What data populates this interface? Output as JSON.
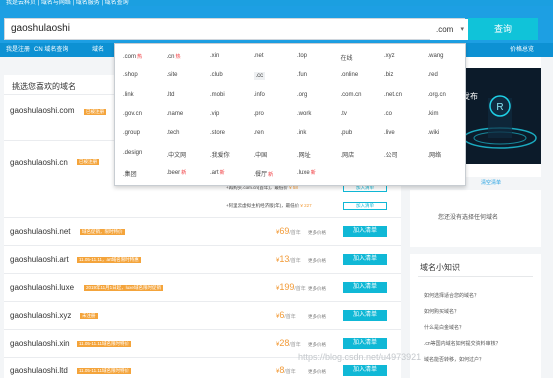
{
  "topbar": {
    "text": "我是云科贝 | 域名与网络 | 域名服务 | 域名查询"
  },
  "search": {
    "value": "gaoshulaoshi",
    "tld_selected": ".com",
    "button": "查询"
  },
  "subnav": {
    "items": [
      "我是注册",
      "CN 域名查询",
      "域名",
      "价格总览"
    ]
  },
  "dropdown": [
    {
      "t": ".com",
      "hot": "热"
    },
    {
      "t": ".cn",
      "hot": "热"
    },
    {
      "t": ".xin"
    },
    {
      "t": ".net"
    },
    {
      "t": ".top"
    },
    {
      "t": "在线"
    },
    {
      "t": ".xyz"
    },
    {
      "t": ".wang"
    },
    {
      "t": ".shop"
    },
    {
      "t": ".site"
    },
    {
      "t": ".club"
    },
    {
      "t": ".cc"
    },
    {
      "t": ".fun"
    },
    {
      "t": ".online"
    },
    {
      "t": ".biz"
    },
    {
      "t": ".red"
    },
    {
      "t": ".link"
    },
    {
      "t": ".ltd"
    },
    {
      "t": ".mobi"
    },
    {
      "t": ".info"
    },
    {
      "t": ".org"
    },
    {
      "t": ".com.cn"
    },
    {
      "t": ".net.cn"
    },
    {
      "t": ".org.cn"
    },
    {
      "t": ".gov.cn"
    },
    {
      "t": ".name"
    },
    {
      "t": ".vip"
    },
    {
      "t": ".pro"
    },
    {
      "t": ".work"
    },
    {
      "t": ".tv"
    },
    {
      "t": ".co"
    },
    {
      "t": ".kim"
    },
    {
      "t": ".group"
    },
    {
      "t": ".tech"
    },
    {
      "t": ".store"
    },
    {
      "t": ".ren"
    },
    {
      "t": ".ink"
    },
    {
      "t": ".pub"
    },
    {
      "t": ".live"
    },
    {
      "t": ".wiki"
    },
    {
      "t": ".design"
    },
    {
      "t": ".中文网"
    },
    {
      "t": ".我爱你"
    },
    {
      "t": ".中国"
    },
    {
      "t": ".网址"
    },
    {
      "t": ".网店"
    },
    {
      "t": ".公司"
    },
    {
      "t": ".网络"
    },
    {
      "t": ".集团"
    },
    {
      "t": ".beer",
      "hot": "新"
    },
    {
      "t": ".art",
      "hot": "新"
    },
    {
      "t": ".餐厅",
      "hot": "新"
    },
    {
      "t": ".luxe",
      "hot": "新"
    }
  ],
  "left": {
    "heading": "挑选您喜欢的域名",
    "rows": [
      {
        "name": "gaoshulaoshi.com",
        "tag": "已被注册"
      },
      {
        "name": "gaoshulaoshi.cn",
        "tag": "已被注册"
      },
      {
        "name": "gaoshulaoshi.net",
        "tag": "域名促销，限时特价",
        "price": "69",
        "more": "更多价格",
        "add": "加入清单"
      },
      {
        "name": "gaoshulaoshi.art",
        "tag": "11.05-11.11，art域名限时特惠",
        "price": "13",
        "more": "更多价格",
        "add": "加入清单"
      },
      {
        "name": "gaoshulaoshi.luxe",
        "tag": "2019年11月1日起，luxe域名限时促销",
        "price": "199",
        "more": "更多价格",
        "add": "加入清单"
      },
      {
        "name": "gaoshulaoshi.xyz",
        "tag": "未注册",
        "price": "6",
        "more": "更多价格",
        "add": "加入清单"
      },
      {
        "name": "gaoshulaoshi.xin",
        "tag": "11.05-11.11域名限时特价",
        "price": "28",
        "more": "更多价格",
        "add": "加入清单"
      },
      {
        "name": "gaoshulaoshi.ltd",
        "tag": "11.05-11.11域名限时特价",
        "price": "8",
        "more": "更多价格",
        "add": "加入清单"
      }
    ],
    "extras": [
      {
        "text": "+再购买.com.cn(首年)，最低价",
        "price": "¥ 58",
        "add": "加入清单"
      },
      {
        "text": "+阿里云虚拟主机经济版(年)，最低价",
        "price": "¥ 227",
        "add": "加入清单"
      }
    ],
    "currency": "¥",
    "unit": "/首年"
  },
  "right": {
    "promo_text": "发布",
    "cart_link": "清空清单",
    "empty": "您还没有选择任何域名",
    "knowledge_title": "域名小知识",
    "knowledge": [
      "如何选择适合您的域名？",
      "如何购买域名？",
      "什么是白金域名？",
      ".cn等国内域名如何提交资料审核？",
      "域名能否转移，如何过户？"
    ]
  },
  "watermark": "https://blog.csdn.net/u4973921"
}
